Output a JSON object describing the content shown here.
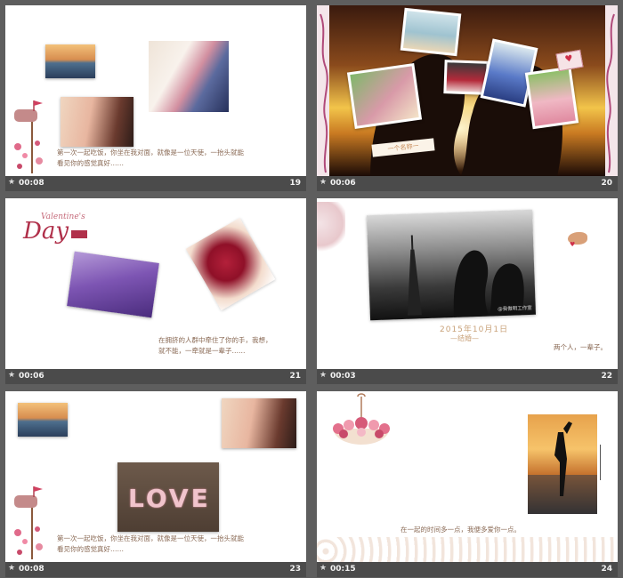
{
  "slides": [
    {
      "num": "19",
      "time": "00:08",
      "caption_line1": "第一次一起吃饭，你坐在我对面，就像是一位天使，一抬头就能",
      "caption_line2": "看见你的感觉真好……"
    },
    {
      "num": "20",
      "time": "00:06",
      "tag": "一个名称一"
    },
    {
      "num": "21",
      "time": "00:06",
      "logo_script": "Valentine's",
      "logo_day": "Day",
      "caption_line1": "在拥挤的人群中牵住了你的手，我想，",
      "caption_line2": "就不能，一牵就是一辈子……"
    },
    {
      "num": "22",
      "time": "00:03",
      "watermark": "@我傲明工作室",
      "date": "2015年10月1日",
      "event": "—结婚—",
      "sub": "两个人，一辈子。"
    },
    {
      "num": "23",
      "time": "00:08",
      "caption_line1": "第一次一起吃饭，你坐在我对面，就像是一位天使，一抬头就能",
      "caption_line2": "看见你的感觉真好……",
      "love_text": "LOVE"
    },
    {
      "num": "24",
      "time": "00:15",
      "caption": "在一起的时间多一点，我便多爱你一点。"
    }
  ],
  "icons": {
    "star": "★"
  }
}
